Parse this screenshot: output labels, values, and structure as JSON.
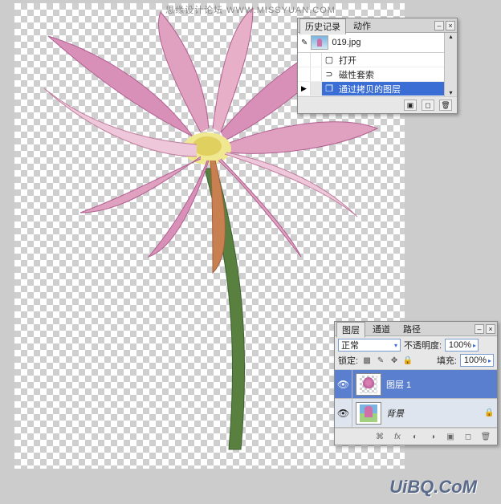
{
  "watermark_top": "思缘设计论坛  WWW.MISSYUAN.COM",
  "watermark_bottom": "UiBQ.CoM",
  "history": {
    "tabs": [
      "历史记录",
      "动作"
    ],
    "active_tab": 0,
    "file_name": "019.jpg",
    "items": [
      {
        "label": "打开",
        "icon": "open"
      },
      {
        "label": "磁性套索",
        "icon": "lasso"
      },
      {
        "label": "通过拷贝的图层",
        "icon": "layer-copy",
        "selected": true
      }
    ]
  },
  "layers": {
    "tabs": [
      "图层",
      "通道",
      "路径"
    ],
    "active_tab": 0,
    "blend_mode": "正常",
    "opacity_label": "不透明度:",
    "opacity_value": "100%",
    "lock_label": "锁定:",
    "fill_label": "填充:",
    "fill_value": "100%",
    "items": [
      {
        "name": "图层 1",
        "visible": true,
        "selected": true,
        "locked": false
      },
      {
        "name": "背景",
        "visible": true,
        "selected": false,
        "locked": true,
        "is_bg": true
      }
    ]
  }
}
